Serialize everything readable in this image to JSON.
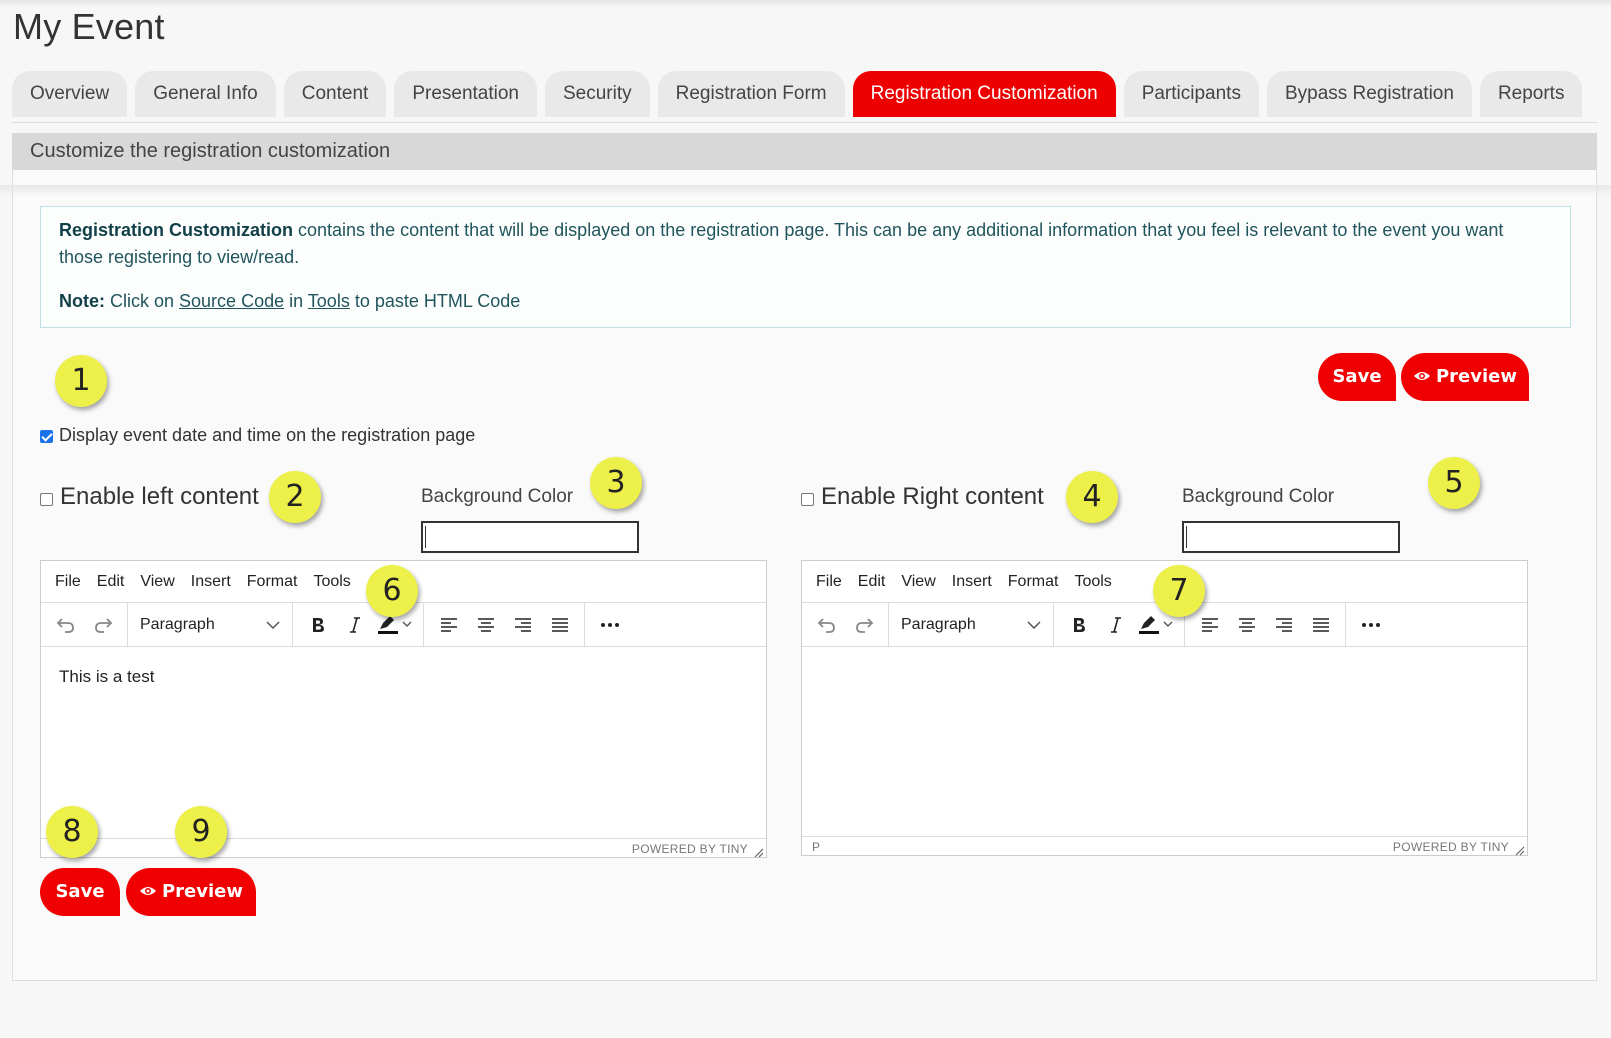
{
  "page": {
    "title": "My Event"
  },
  "tabs": [
    {
      "label": "Overview"
    },
    {
      "label": "General Info"
    },
    {
      "label": "Content"
    },
    {
      "label": "Presentation"
    },
    {
      "label": "Security"
    },
    {
      "label": "Registration Form"
    },
    {
      "label": "Registration Customization",
      "active": true
    },
    {
      "label": "Participants"
    },
    {
      "label": "Bypass Registration"
    },
    {
      "label": "Reports"
    }
  ],
  "panel": {
    "heading": "Customize the registration customization"
  },
  "info": {
    "bold_lead": "Registration Customization",
    "text": " contains the content that will be displayed on the registration page. This can be any additional information that you feel is relevant to the event you want those registering to view/read.",
    "note_label": "Note:",
    "note_pre": " Click on ",
    "note_link1": "Source Code",
    "note_mid": " in ",
    "note_link2": "Tools",
    "note_post": " to paste HTML Code"
  },
  "actions": {
    "save": "Save",
    "preview": "Preview"
  },
  "display_date_checkbox": {
    "label": "Display event date and time on the registration page",
    "checked": true
  },
  "left": {
    "enable_label": "Enable left content",
    "checked": false,
    "bg_label": "Background Color",
    "bg_value": "",
    "content": "This is a test",
    "status_path": "",
    "powered": "POWERED BY TINY"
  },
  "right": {
    "enable_label": "Enable Right content",
    "checked": false,
    "bg_label": "Background Color",
    "bg_value": "",
    "content": "",
    "status_path": "P",
    "powered": "POWERED BY TINY"
  },
  "editor_menu": [
    "File",
    "Edit",
    "View",
    "Insert",
    "Format",
    "Tools"
  ],
  "editor_block_format": "Paragraph",
  "callouts": [
    "1",
    "2",
    "3",
    "4",
    "5",
    "6",
    "7",
    "8",
    "9"
  ],
  "colors": {
    "accent": "#ee0000",
    "callout": "#eef04a",
    "info_text": "#21555d",
    "info_border": "#bfe0e3"
  }
}
